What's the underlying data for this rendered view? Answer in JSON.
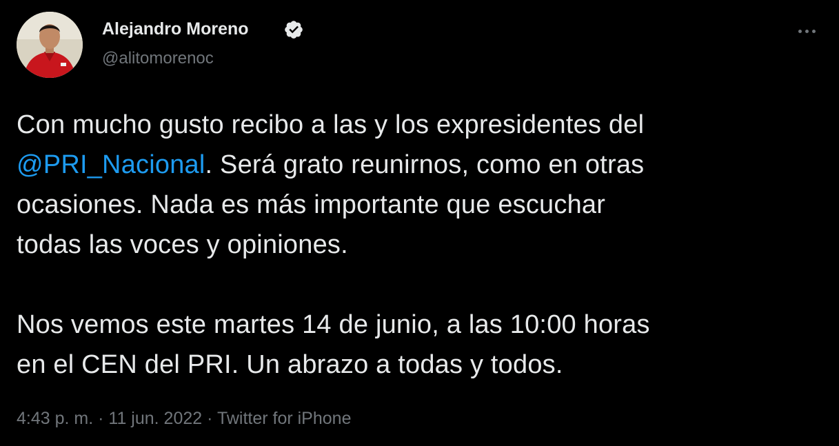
{
  "author": {
    "display_name": "Alejandro Moreno",
    "handle": "@alitomorenoc",
    "verified_icon": "verified-badge-icon"
  },
  "menu": {
    "icon": "more-options-icon"
  },
  "tweet": {
    "line1": "Con mucho gusto recibo a las y los expresidentes del",
    "mention": "@PRI_Nacional",
    "line2_rest": ". Será grato reunirnos, como en otras",
    "line3": "ocasiones. Nada es más importante que escuchar",
    "line4": "todas las voces y opiniones.",
    "line5": "Nos vemos este martes 14 de junio, a las 10:00 horas",
    "line6": "en el CEN del PRI. Un abrazo a todas y todos."
  },
  "meta": {
    "time": "4:43 p. m.",
    "sep1": " · ",
    "date": "11 jun. 2022",
    "sep2": " · ",
    "source": "Twitter for iPhone"
  },
  "colors": {
    "background": "#000000",
    "text": "#e7e9ea",
    "secondary": "#71767b",
    "accent": "#1d9bf0"
  }
}
